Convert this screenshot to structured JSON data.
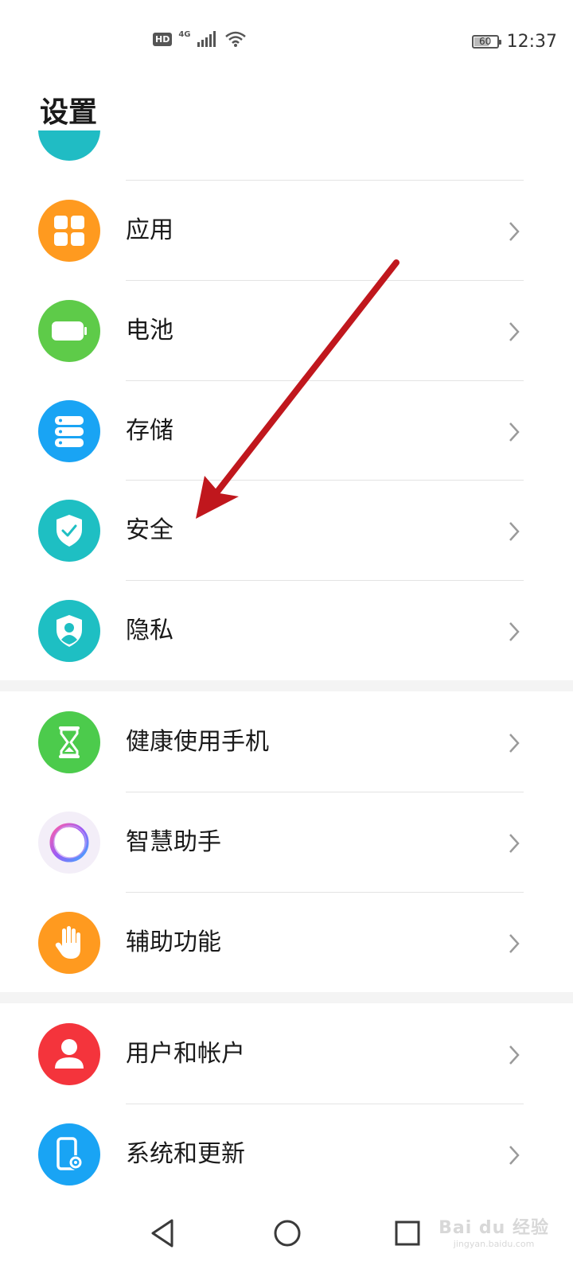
{
  "status_bar": {
    "hd": "HD",
    "network": "4G",
    "battery": "60",
    "time": "12:37"
  },
  "header": {
    "title": "设置"
  },
  "settings": {
    "group1": [
      {
        "label": "应用",
        "icon": "apps-grid-icon",
        "color": "#ff9a1f"
      },
      {
        "label": "电池",
        "icon": "battery-icon",
        "color": "#5ecb49"
      },
      {
        "label": "存储",
        "icon": "storage-icon",
        "color": "#19a4f4"
      },
      {
        "label": "安全",
        "icon": "shield-check-icon",
        "color": "#1ebfc3"
      },
      {
        "label": "隐私",
        "icon": "privacy-shield-icon",
        "color": "#1ebfc3"
      }
    ],
    "group2": [
      {
        "label": "健康使用手机",
        "icon": "hourglass-icon",
        "color": "#4ccb4c"
      },
      {
        "label": "智慧助手",
        "icon": "assistant-ring-icon",
        "color": "#f3eef8"
      },
      {
        "label": "辅助功能",
        "icon": "hand-icon",
        "color": "#ff9a1f"
      }
    ],
    "group3": [
      {
        "label": "用户和帐户",
        "icon": "user-icon",
        "color": "#f4343c"
      },
      {
        "label": "系统和更新",
        "icon": "phone-gear-icon",
        "color": "#19a4f4"
      }
    ]
  },
  "annotation": {
    "arrow_color": "#c0171d"
  },
  "watermark": {
    "text": "Bai du 经验",
    "sub": "jingyan.baidu.com"
  }
}
